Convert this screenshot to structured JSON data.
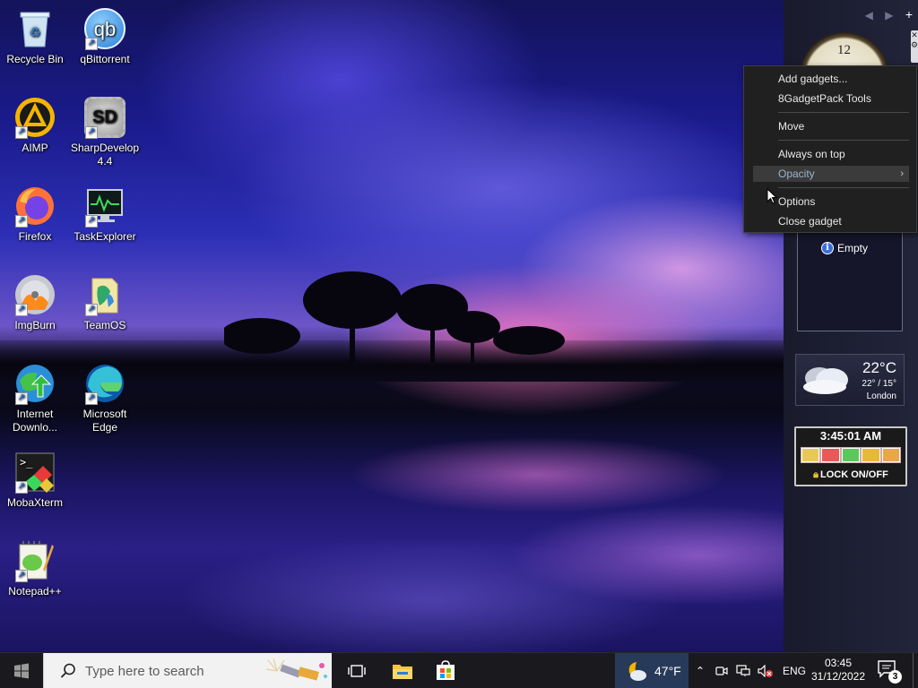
{
  "desktop": {
    "icons": [
      {
        "label": "Recycle Bin"
      },
      {
        "label": "qBittorrent",
        "glyph": "qb"
      },
      {
        "label": "AIMP"
      },
      {
        "label": "SharpDevelop 4.4",
        "glyph": "SD"
      },
      {
        "label": "Firefox"
      },
      {
        "label": "TaskExplorer"
      },
      {
        "label": "ImgBurn"
      },
      {
        "label": "TeamOS"
      },
      {
        "label": "Internet Downlo..."
      },
      {
        "label": "Microsoft Edge"
      },
      {
        "label": "MobaXterm"
      },
      {
        "label": "Notepad++"
      }
    ]
  },
  "sidebar": {
    "nav": {
      "prev": "◀",
      "next": "▶",
      "add": "+"
    },
    "clock_numeral": "12",
    "slideshow": {
      "empty_label": "Empty",
      "info_glyph": "i"
    },
    "weather": {
      "temp": "22°C",
      "range": "22° / 15°",
      "city": "London"
    },
    "lock_gadget": {
      "time": "3:45:01 AM",
      "label": "LOCK ON/OFF"
    }
  },
  "context_menu": {
    "items": [
      {
        "label": "Add gadgets..."
      },
      {
        "label": "8GadgetPack Tools"
      },
      {
        "label": "Move"
      },
      {
        "label": "Always on top"
      },
      {
        "label": "Opacity",
        "arrow": "›",
        "highlighted": true
      },
      {
        "label": "Options"
      },
      {
        "label": "Close gadget"
      }
    ]
  },
  "taskbar": {
    "search_placeholder": "Type here to search",
    "weather_temp": "47°F",
    "language": "ENG",
    "time": "03:45",
    "date": "31/12/2022",
    "notification_count": "3",
    "tray_arrow": "⌃"
  },
  "colors": {
    "menu_bg": "#202020",
    "menu_highlight": "#3b3b3b",
    "taskbar_bg": "#1a1a1e",
    "sidebar_bg": "#1d1e32"
  }
}
